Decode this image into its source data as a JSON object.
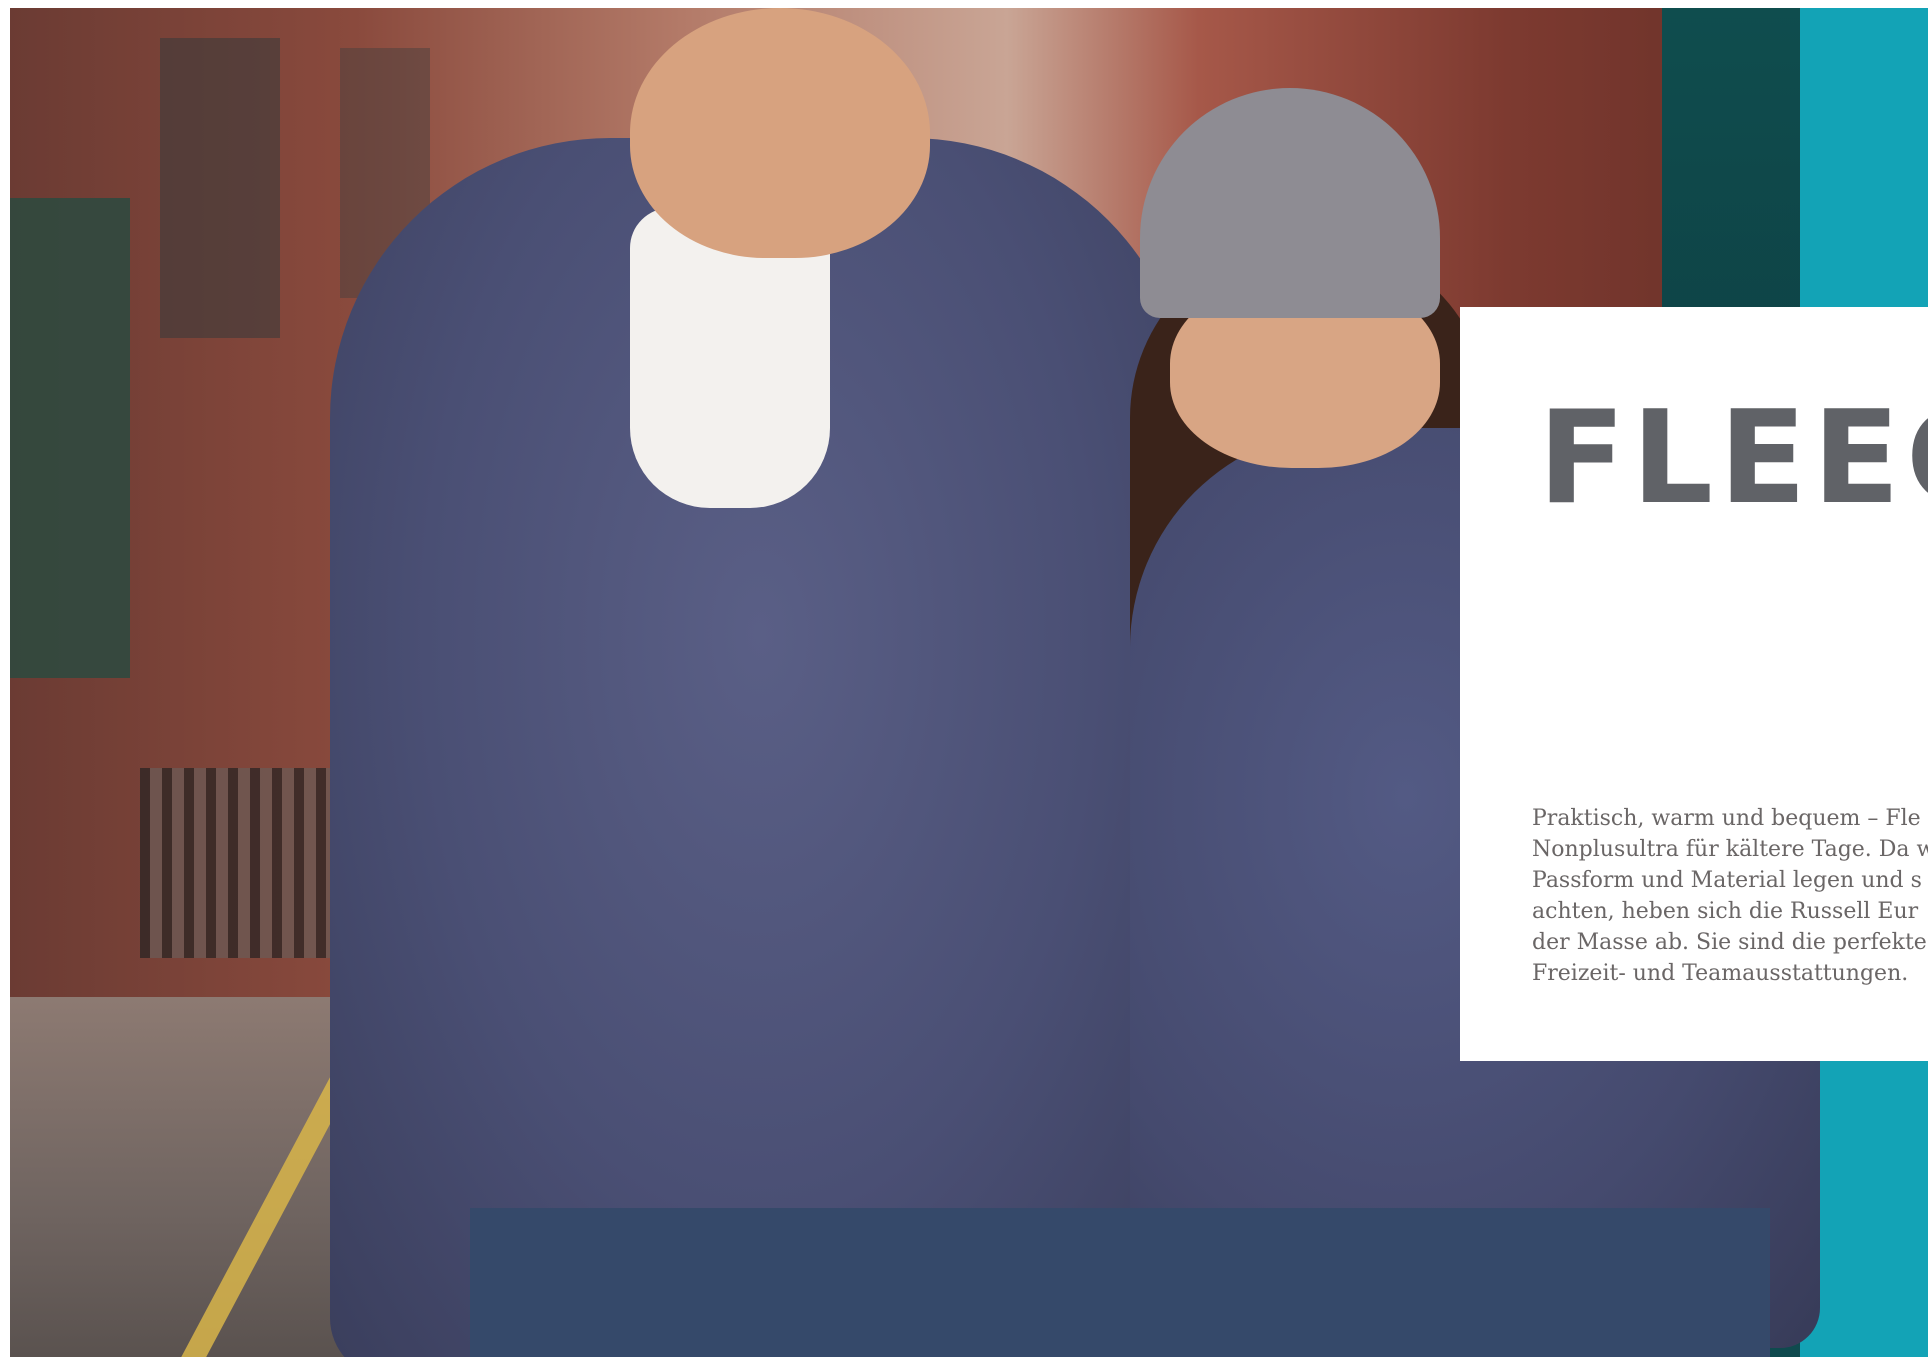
{
  "card": {
    "title": "FLEEC",
    "body_lines": [
      "Praktisch, warm und bequem – Fle",
      "Nonplusultra für kältere Tage. Da w",
      "Passform und Material legen und s",
      "achten, heben sich die Russell Eur",
      "der Masse ab. Sie sind die perfekte",
      "Freizeit- und Teamausstattungen."
    ]
  },
  "colors": {
    "title": "#606267",
    "body_text": "#6a6666",
    "accent_teal": "#13a3b6",
    "card_background": "#ffffff"
  }
}
